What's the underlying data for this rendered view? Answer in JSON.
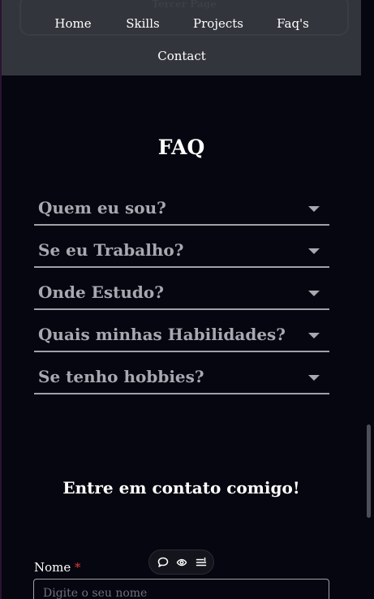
{
  "nav": {
    "ghost_label": "Tercer Page",
    "links": [
      {
        "label": "Home"
      },
      {
        "label": "Skills"
      },
      {
        "label": "Projects"
      },
      {
        "label": "Faq's"
      },
      {
        "label": "Contact"
      }
    ]
  },
  "faq": {
    "title": "FAQ",
    "items": [
      {
        "label": "Quem eu sou?"
      },
      {
        "label": "Se eu Trabalho?"
      },
      {
        "label": "Onde Estudo?"
      },
      {
        "label": "Quais minhas Habilidades?"
      },
      {
        "label": "Se tenho hobbies?"
      }
    ]
  },
  "contact": {
    "title": "Entre em contato comigo!",
    "name_label": "Nome",
    "required_mark": "*",
    "name_placeholder": "Digite o seu nome",
    "name_value": ""
  },
  "toolbar": {
    "icons": [
      "comment-icon",
      "view-icon",
      "menu-icon"
    ]
  },
  "colors": {
    "background": "#05060f",
    "navbar": "#33353c",
    "faq_text": "#a7a8b0",
    "required": "#e53935"
  }
}
